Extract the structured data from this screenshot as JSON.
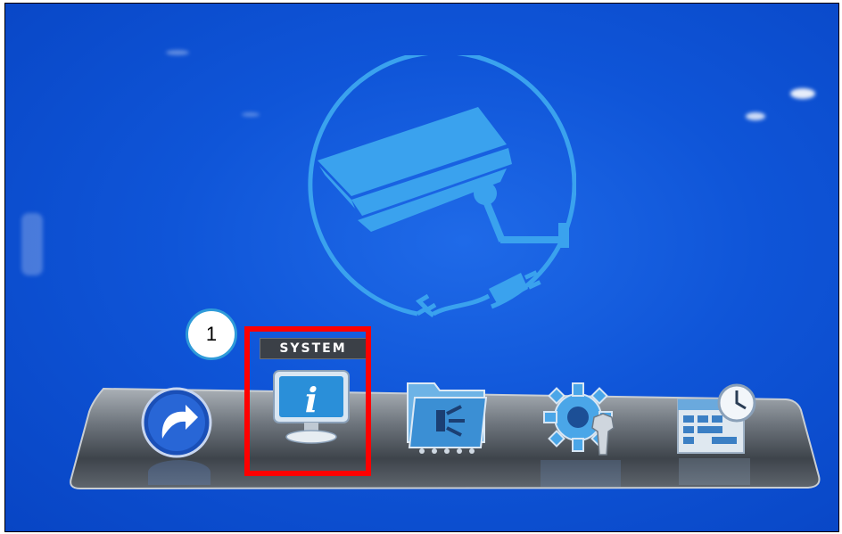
{
  "menu": {
    "selected_label": "SYSTEM",
    "items": [
      {
        "name": "back",
        "icon": "return-arrow-icon"
      },
      {
        "name": "system",
        "icon": "system-info-monitor-icon"
      },
      {
        "name": "record",
        "icon": "record-folder-icon"
      },
      {
        "name": "settings",
        "icon": "gear-wrench-icon"
      },
      {
        "name": "schedule",
        "icon": "calendar-clock-icon"
      }
    ]
  },
  "annotation": {
    "callout_number": "1",
    "highlight_color": "#ff0000"
  },
  "colors": {
    "background": "#0f55d8",
    "logo_stroke": "#3aa2ee"
  }
}
